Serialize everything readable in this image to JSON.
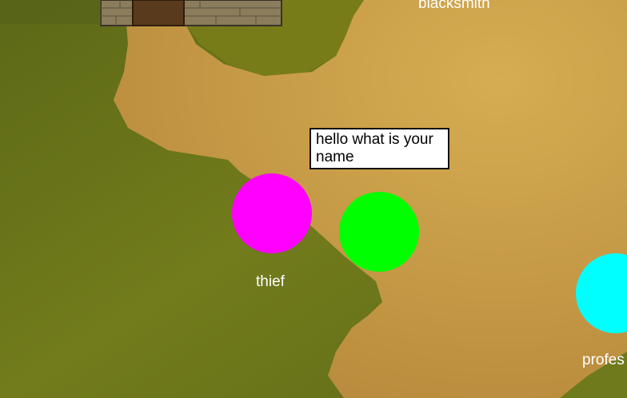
{
  "world": {
    "colors": {
      "grass_dark": "#5e6a16",
      "grass": "#7a7e18",
      "dirt": "#c79a45",
      "dirt_light": "#d2a94e",
      "building_wall": "#8a7a5a",
      "door": "#5a3a1c"
    }
  },
  "dialog": {
    "text": "hello what is your name"
  },
  "characters": [
    {
      "id": "thief",
      "label": "thief",
      "color": "#ff00ff"
    },
    {
      "id": "player",
      "label": "",
      "color": "#00ff00"
    },
    {
      "id": "professor",
      "label": "profes",
      "color": "#00ffff"
    },
    {
      "id": "blacksmith",
      "label": "blacksmith",
      "color": ""
    }
  ]
}
